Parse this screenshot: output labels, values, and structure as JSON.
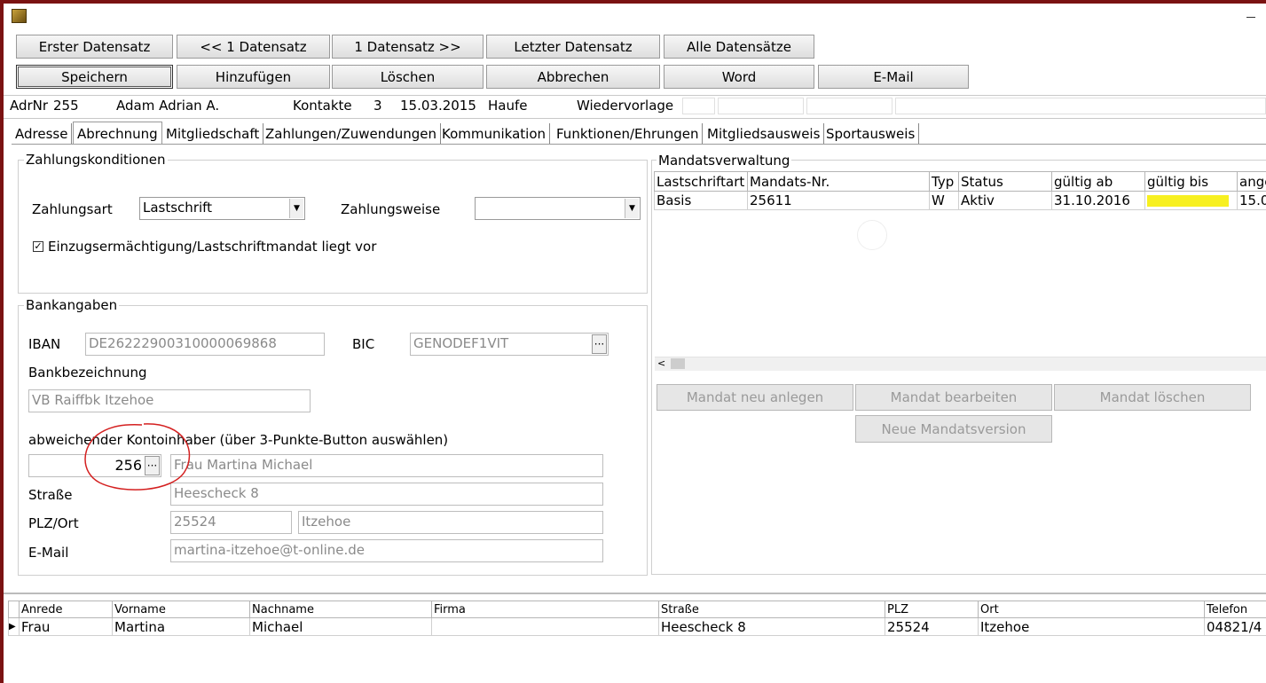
{
  "nav_buttons": {
    "first": "Erster Datensatz",
    "prev": "<< 1 Datensatz",
    "next": "1 Datensatz >>",
    "last": "Letzter Datensatz",
    "all": "Alle Datensätze"
  },
  "action_buttons": {
    "save": "Speichern",
    "add": "Hinzufügen",
    "delete": "Löschen",
    "cancel": "Abbrechen",
    "word": "Word",
    "email": "E-Mail"
  },
  "info_bar": {
    "adrnr_label": "AdrNr",
    "adrnr_value": "255",
    "name": "Adam Adrian A.",
    "kontakte_label": "Kontakte",
    "kontakte_value": "3",
    "date": "15.03.2015",
    "haufe": "Haufe",
    "wiedervorlage": "Wiedervorlage"
  },
  "tabs": [
    "Adresse",
    "Abrechnung",
    "Mitgliedschaft",
    "Zahlungen/Zuwendungen",
    "Kommunikation",
    "Funktionen/Ehrungen",
    "Mitgliedsausweis",
    "Sportausweis"
  ],
  "zahlung": {
    "title": "Zahlungskonditionen",
    "zahlungsart_label": "Zahlungsart",
    "zahlungsart_value": "Lastschrift",
    "zahlungsweise_label": "Zahlungsweise",
    "zahlungsweise_value": "",
    "mandate_check_label": "Einzugsermächtigung/Lastschriftmandat liegt vor",
    "mandate_checked": "✓"
  },
  "bank": {
    "title": "Bankangaben",
    "iban_label": "IBAN",
    "iban_value": "DE26222900310000069868",
    "bic_label": "BIC",
    "bic_value": "GENODEF1VIT",
    "bankname_label": "Bankbezeichnung",
    "bankname_value": "VB Raiffbk Itzehoe",
    "holder_hint": "abweichender Kontoinhaber (über 3-Punkte-Button auswählen)",
    "holder_id": "256",
    "holder_name": "Frau Martina Michael",
    "strasse_label": "Straße",
    "strasse_value": "Heescheck 8",
    "plzort_label": "PLZ/Ort",
    "plz_value": "25524",
    "ort_value": "Itzehoe",
    "email_label": "E-Mail",
    "email_value": "martina-itzehoe@t-online.de"
  },
  "mandat": {
    "title": "Mandatsverwaltung",
    "columns": [
      "Lastschriftart",
      "Mandats-Nr.",
      "Typ",
      "Status",
      "gültig ab",
      "gültig bis",
      "ange"
    ],
    "rows": [
      [
        "Basis",
        "25611",
        "W",
        "Aktiv",
        "31.10.2016",
        "",
        "15.0"
      ]
    ],
    "btn_new": "Mandat neu anlegen",
    "btn_edit": "Mandat bearbeiten",
    "btn_delete": "Mandat löschen",
    "btn_version": "Neue Mandatsversion",
    "highlight_color": "#f7f020"
  },
  "holder_grid": {
    "columns": [
      "Anrede",
      "Vorname",
      "Nachname",
      "Firma",
      "Straße",
      "PLZ",
      "Ort",
      "Telefon"
    ],
    "rows": [
      [
        "Frau",
        "Martina",
        "Michael",
        "",
        "Heescheck 8",
        "25524",
        "Itzehoe",
        "04821/4"
      ]
    ]
  },
  "annotation_color": "#d42020"
}
